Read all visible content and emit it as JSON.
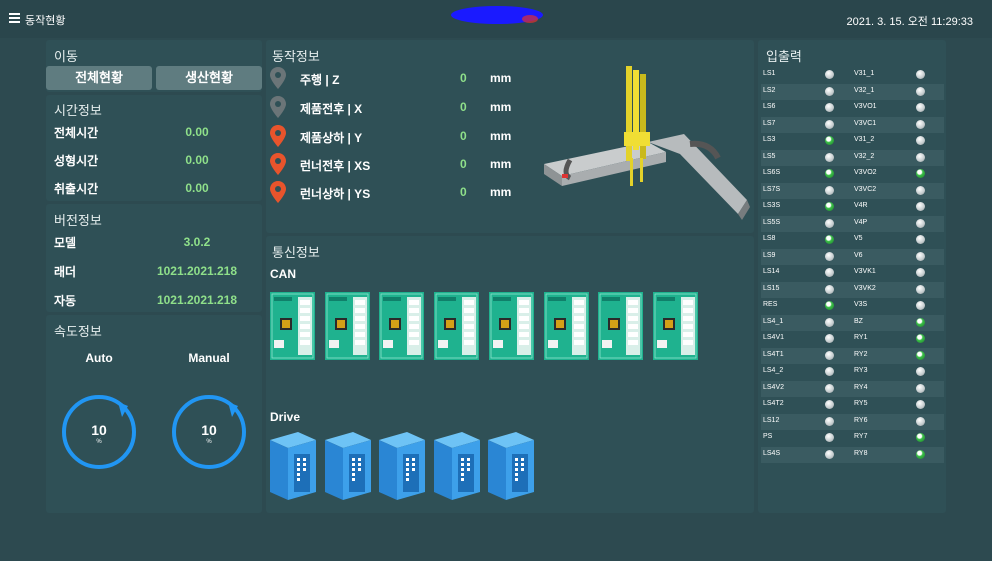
{
  "header": {
    "title": "동작현황",
    "datetime": "2021. 3. 15. 오전 11:29:33"
  },
  "move": {
    "title": "이동",
    "buttons": [
      "전체현황",
      "생산현황"
    ]
  },
  "time_info": {
    "title": "시간정보",
    "rows": [
      {
        "label": "전체시간",
        "value": "0.00"
      },
      {
        "label": "성형시간",
        "value": "0.00"
      },
      {
        "label": "취출시간",
        "value": "0.00"
      }
    ]
  },
  "version_info": {
    "title": "버전정보",
    "rows": [
      {
        "label": "모델",
        "value": "3.0.2"
      },
      {
        "label": "래더",
        "value": "1021.2021.218"
      },
      {
        "label": "자동",
        "value": "1021.2021.218"
      }
    ]
  },
  "speed_info": {
    "title": "속도정보",
    "auto": {
      "label": "Auto",
      "value": "10",
      "unit": "%"
    },
    "manual": {
      "label": "Manual",
      "value": "10",
      "unit": "%"
    }
  },
  "motion_info": {
    "title": "동작정보",
    "rows": [
      {
        "label": "주행 | Z",
        "value": "0",
        "unit": "mm",
        "pin": "gray"
      },
      {
        "label": "제품전후 | X",
        "value": "0",
        "unit": "mm",
        "pin": "gray"
      },
      {
        "label": "제품상하 | Y",
        "value": "0",
        "unit": "mm",
        "pin": "orange"
      },
      {
        "label": "런너전후 | XS",
        "value": "0",
        "unit": "mm",
        "pin": "orange"
      },
      {
        "label": "런너상하 | YS",
        "value": "0",
        "unit": "mm",
        "pin": "orange"
      }
    ]
  },
  "comm_info": {
    "title": "통신정보",
    "can_label": "CAN",
    "drive_label": "Drive",
    "can_count": 8,
    "drive_count": 5
  },
  "io": {
    "title": "입출력",
    "rows": [
      {
        "a": "LS1",
        "a_on": false,
        "b": "V31_1",
        "b_on": false
      },
      {
        "a": "LS2",
        "a_on": false,
        "b": "V32_1",
        "b_on": false
      },
      {
        "a": "LS6",
        "a_on": false,
        "b": "V3VO1",
        "b_on": false
      },
      {
        "a": "LS7",
        "a_on": false,
        "b": "V3VC1",
        "b_on": false
      },
      {
        "a": "LS3",
        "a_on": true,
        "b": "V31_2",
        "b_on": false
      },
      {
        "a": "LS5",
        "a_on": false,
        "b": "V32_2",
        "b_on": false
      },
      {
        "a": "LS6S",
        "a_on": true,
        "b": "V3VO2",
        "b_on": true
      },
      {
        "a": "LS7S",
        "a_on": false,
        "b": "V3VC2",
        "b_on": false
      },
      {
        "a": "LS3S",
        "a_on": true,
        "b": "V4R",
        "b_on": false
      },
      {
        "a": "LS5S",
        "a_on": false,
        "b": "V4P",
        "b_on": false
      },
      {
        "a": "LS8",
        "a_on": true,
        "b": "V5",
        "b_on": false
      },
      {
        "a": "LS9",
        "a_on": false,
        "b": "V6",
        "b_on": false
      },
      {
        "a": "LS14",
        "a_on": false,
        "b": "V3VK1",
        "b_on": false
      },
      {
        "a": "LS15",
        "a_on": false,
        "b": "V3VK2",
        "b_on": false
      },
      {
        "a": "RES",
        "a_on": true,
        "b": "V3S",
        "b_on": false
      },
      {
        "a": "LS4_1",
        "a_on": false,
        "b": "BZ",
        "b_on": true
      },
      {
        "a": "LS4V1",
        "a_on": false,
        "b": "RY1",
        "b_on": true
      },
      {
        "a": "LS4T1",
        "a_on": false,
        "b": "RY2",
        "b_on": true
      },
      {
        "a": "LS4_2",
        "a_on": false,
        "b": "RY3",
        "b_on": false
      },
      {
        "a": "LS4V2",
        "a_on": false,
        "b": "RY4",
        "b_on": false
      },
      {
        "a": "LS4T2",
        "a_on": false,
        "b": "RY5",
        "b_on": false
      },
      {
        "a": "LS12",
        "a_on": false,
        "b": "RY6",
        "b_on": false
      },
      {
        "a": "PS",
        "a_on": false,
        "b": "RY7",
        "b_on": true
      },
      {
        "a": "LS4S",
        "a_on": false,
        "b": "RY8",
        "b_on": true
      }
    ]
  },
  "colors": {
    "accent_green": "#8fe08a",
    "gauge_blue": "#2196f3",
    "pin_orange": "#e8542c",
    "pin_gray": "#6b7578"
  }
}
